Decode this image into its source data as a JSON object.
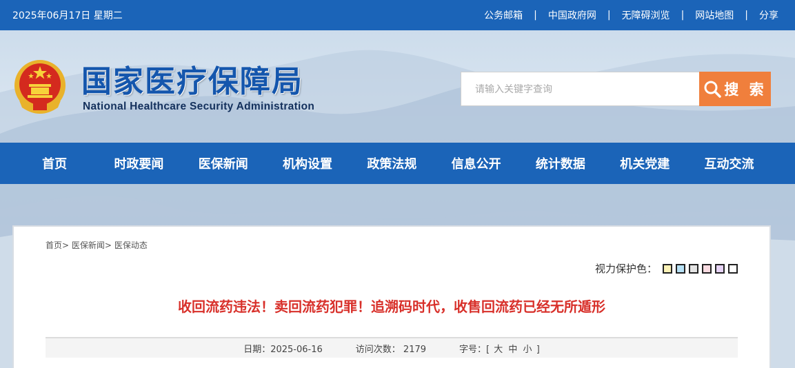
{
  "topbar": {
    "date": "2025年06月17日 星期二",
    "links": [
      "公务邮箱",
      "中国政府网",
      "无障碍浏览",
      "网站地图",
      "分享"
    ],
    "separator": "|"
  },
  "header": {
    "logo_cn": "国家医疗保障局",
    "logo_en": "National Healthcare Security Administration",
    "search": {
      "placeholder": "请输入关键字查询",
      "button_label": "搜 索"
    }
  },
  "nav": {
    "items": [
      "首页",
      "时政要闻",
      "医保新闻",
      "机构设置",
      "政策法规",
      "信息公开",
      "统计数据",
      "机关党建",
      "互动交流"
    ]
  },
  "breadcrumb": {
    "items": [
      "首页",
      "医保新闻",
      "医保动态"
    ],
    "separator": ">"
  },
  "eyecare": {
    "label": "视力保护色：",
    "colors": [
      "#fbf2b7",
      "#b7e1f5",
      "#e3e3e3",
      "#f9dbe1",
      "#e6d3f5",
      "#ffffff"
    ]
  },
  "article": {
    "title": "收回流药违法！卖回流药犯罪！追溯码时代，收售回流药已经无所遁形",
    "date": "日期：2025-06-16",
    "visits_label": "访问次数：",
    "visits": "2179",
    "font_size": {
      "label": "字号：[",
      "large": "大",
      "medium": "中",
      "small": "小",
      "close": "]"
    }
  },
  "colors": {
    "brand_blue": "#1b64b8",
    "search_orange": "#f07f3c",
    "title_red": "#d8302a"
  }
}
